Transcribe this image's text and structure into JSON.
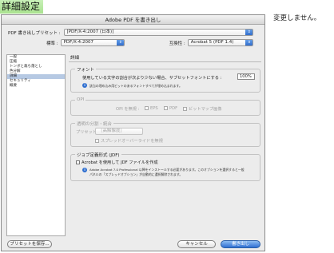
{
  "page": {
    "heading": "詳細設定",
    "side_note": "変更しません。"
  },
  "dialog": {
    "title": "Adobe PDF を書き出し",
    "preset_label": "PDF 書き出しプリセット :",
    "preset_value": "[PDF/X-4:2007 (日本)]",
    "standard_label": "標準 :",
    "standard_value": "PDF/X-4:2007",
    "compat_label": "互換性 :",
    "compat_value": "Acrobat 5 (PDF 1.4)"
  },
  "sidebar": {
    "items": [
      {
        "label": "一般",
        "selected": false
      },
      {
        "label": "圧縮",
        "selected": false
      },
      {
        "label": "トンボと裁ち落とし",
        "selected": false
      },
      {
        "label": "色分解",
        "selected": false
      },
      {
        "label": "詳細",
        "selected": true
      },
      {
        "label": "セキュリティ",
        "selected": false
      },
      {
        "label": "概要",
        "selected": false
      }
    ]
  },
  "pane": {
    "title": "詳細",
    "font_group": {
      "label": "フォント",
      "subset_text": "使用している文字の割合が次より少ない場合、サブセットフォントにする :",
      "subset_value": "100%",
      "note": "該当の埋め込み用ビットのあるフォントすべてが埋め込まれます。"
    },
    "opi_group": {
      "label": "OPI",
      "omit_label": "OPI を無視 :",
      "eps": "EPS",
      "pdf": "PDF",
      "bitmap": "ビットマップ画像"
    },
    "flatten_group": {
      "label": "透明の分割・統合",
      "preset_label": "プリセット :",
      "preset_value": "［高解像度］",
      "override_label": "スプレッドオーバーライドを無視"
    },
    "jdf_group": {
      "label": "ジョブ定義形式 (JDF)",
      "create_label": "Acrobat を使用して JDF ファイルを作成",
      "note_line1": "Adobe Acrobat 7.0 Professional 以降をインストールする必要があります。このオプションを選択すると一般",
      "note_line2": "パネルの「スプレッドオプション」が自動的に選択解除されます。"
    }
  },
  "footer": {
    "save_preset": "プリセットを保存...",
    "cancel": "キャンセル",
    "export": "書き出し"
  }
}
